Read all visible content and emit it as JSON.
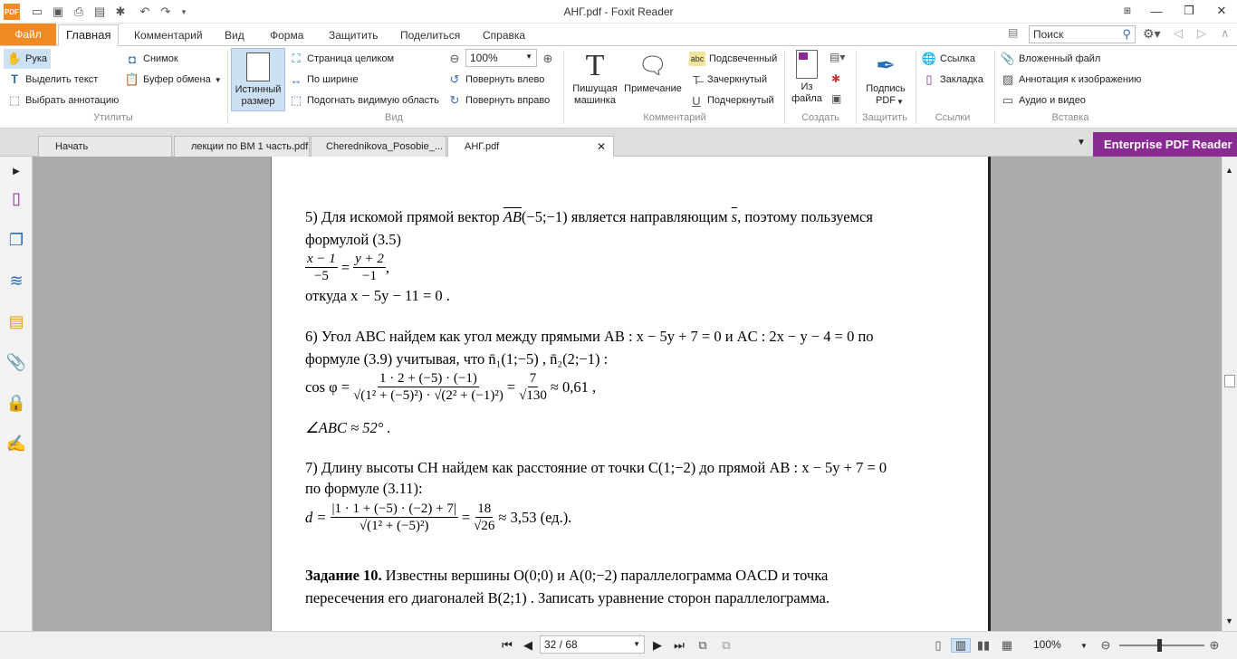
{
  "window": {
    "title": "АНГ.pdf - Foxit Reader"
  },
  "ribbon_tabs": [
    "Файл",
    "Главная",
    "Комментарий",
    "Вид",
    "Форма",
    "Защитить",
    "Поделиться",
    "Справка"
  ],
  "search": {
    "placeholder": "Поиск"
  },
  "ribbon": {
    "utilities": {
      "hand": "Рука",
      "select_text": "Выделить текст",
      "select_annotation": "Выбрать аннотацию",
      "snapshot": "Снимок",
      "clipboard": "Буфер обмена",
      "group": "Утилиты"
    },
    "view": {
      "actual_size": "Истинный размер",
      "fit_page": "Страница целиком",
      "fit_width": "По ширине",
      "fit_visible": "Подогнать видимую область",
      "zoom_value": "100%",
      "rotate_left": "Повернуть влево",
      "rotate_right": "Повернуть вправо",
      "group": "Вид"
    },
    "comment": {
      "typewriter": "Пишущая машинка",
      "note": "Примечание",
      "highlight": "Подсвеченный",
      "strikeout": "Зачеркнутый",
      "underline": "Подчеркнутый",
      "group": "Комментарий",
      "abc_icon": "abc",
      "u_icon": "U",
      "t_icon": "T"
    },
    "create": {
      "from_file": "Из файла",
      "group": "Создать"
    },
    "protect": {
      "sign": "Подпись PDF",
      "group": "Защитить"
    },
    "links": {
      "link": "Ссылка",
      "bookmark": "Закладка",
      "group": "Ссылки"
    },
    "insert": {
      "attachment": "Вложенный файл",
      "image_annotation": "Аннотация к изображению",
      "audio_video": "Аудио и видео",
      "group": "Вставка"
    }
  },
  "doc_tabs": [
    "Начать",
    "лекции по ВМ 1 часть.pdf",
    "Cherednikova_Posobie_...",
    "АНГ.pdf"
  ],
  "enterprise": "Enterprise PDF Reader",
  "document": {
    "p5_line1a": "5) Для искомой прямой вектор",
    "p5_vec": "AB",
    "p5_vecargs": "(−5;−1)",
    "p5_line1b": "является направляющим",
    "p5_s": "s",
    "p5_line1c": ", поэтому пользуемся",
    "p5_line2": "формулой (3.5)",
    "p5_frac1_num": "x − 1",
    "p5_frac1_den": "−5",
    "p5_eq": "=",
    "p5_frac2_num": "y + 2",
    "p5_frac2_den": "−1",
    "p5_comma": ",",
    "p5_line4": "откуда  x − 5y − 11 = 0 .",
    "p6_line1": "6) Угол  ABC найдем как угол между прямыми  AB :  x − 5y + 7 = 0  и  AC :  2x − y − 4 = 0  по",
    "p6_line2": "формуле (3.9) учитывая, что  n̄₁(1;−5) ,  n̄₂(2;−1) :",
    "p6_cos": "cos φ =",
    "p6_num": "1 · 2 + (−5) · (−1)",
    "p6_den": "√(1² + (−5)²) · √(2² + (−1)²)",
    "p6_eq2": "=",
    "p6_num2": "7",
    "p6_den2": "√130",
    "p6_tail": "≈ 0,61 ,",
    "p6_angle": "∠ABC ≈ 52° .",
    "p7_line1": "7) Длину высоты  CH  найдем как расстояние от точки  C(1;−2)  до прямой  AB :  x − 5y + 7 = 0",
    "p7_line2": "по формуле (3.11):",
    "p7_d": "d =",
    "p7_num": "|1 · 1 + (−5) · (−2) + 7|",
    "p7_den": "√(1² + (−5)²)",
    "p7_eq2": "=",
    "p7_num2": "18",
    "p7_den2": "√26",
    "p7_tail": "≈ 3,53  (ед.).",
    "task_bold": "Задание 10.",
    "task_line1": " Известны вершины  O(0;0)  и  A(0;−2)  параллелограмма  OACD  и точка",
    "task_line2": "пересечения его диагоналей  B(2;1) . Записать уравнение сторон параллелограмма."
  },
  "status": {
    "page": "32 / 68",
    "zoom": "100%"
  }
}
